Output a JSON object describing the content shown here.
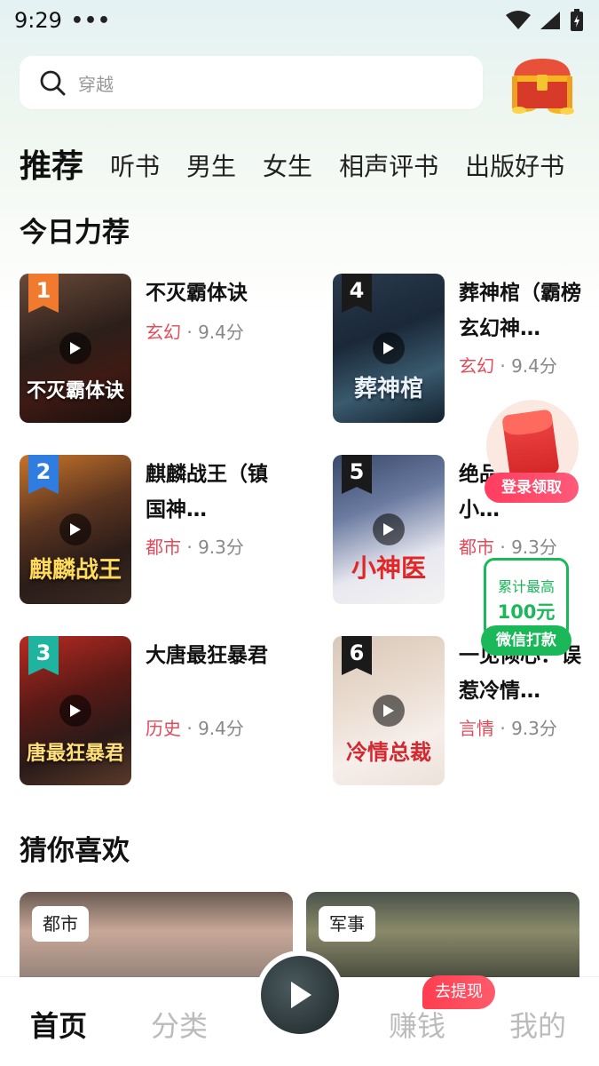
{
  "status_bar": {
    "time": "9:29",
    "dots": "•••"
  },
  "search": {
    "placeholder": "穿越"
  },
  "tabs": [
    "推荐",
    "听书",
    "男生",
    "女生",
    "相声评书",
    "出版好书"
  ],
  "sections": {
    "today": "今日力荐",
    "guess": "猜你喜欢"
  },
  "books": [
    {
      "rank": "1",
      "title": "不灭霸体诀",
      "genre": "玄幻",
      "score": "· 9.4分",
      "cover_text": "不灭霸体诀",
      "rank_color": "#f07a2e"
    },
    {
      "rank": "2",
      "title": "麒麟战王（镇国神…",
      "genre": "都市",
      "score": "· 9.3分",
      "cover_text": "麒麟战王",
      "rank_color": "#2f7de1"
    },
    {
      "rank": "3",
      "title": "大唐最狂暴君",
      "genre": "历史",
      "score": "· 9.4分",
      "cover_text": "唐最狂暴君",
      "rank_color": "#1fb4a0"
    },
    {
      "rank": "4",
      "title": "葬神棺（霸榜玄幻神…",
      "genre": "玄幻",
      "score": "· 9.4分",
      "cover_text": "葬神棺",
      "rank_color": "#1a1a1a"
    },
    {
      "rank": "5",
      "title": "绝品（桃运小…",
      "genre": "都市",
      "score": "· 9.3分",
      "cover_text": "小神医",
      "rank_color": "#1a1a1a"
    },
    {
      "rank": "6",
      "title": "一见倾心：误惹冷情…",
      "genre": "言情",
      "score": "· 9.3分",
      "cover_text": "冷情总裁",
      "rank_color": "#1a1a1a"
    }
  ],
  "float_redpacket": {
    "label": "登录领取"
  },
  "float_wechat": {
    "line1": "累计最高",
    "line2": "100元",
    "button": "微信打款"
  },
  "guess_cards": [
    {
      "tag": "都市"
    },
    {
      "tag": "军事"
    }
  ],
  "bottom_nav": {
    "home": "首页",
    "category": "分类",
    "earn": "赚钱",
    "mine": "我的",
    "earn_badge": "去提现"
  },
  "colors": {
    "accent_red": "#e24a5a",
    "wechat_green": "#1bb85a"
  }
}
